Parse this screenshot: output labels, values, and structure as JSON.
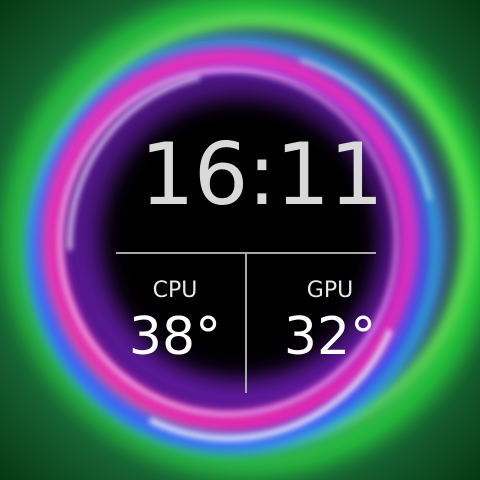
{
  "clock": {
    "time": "16:11"
  },
  "stats": {
    "cpu": {
      "label": "CPU",
      "value": "38°"
    },
    "gpu": {
      "label": "GPU",
      "value": "32°"
    }
  },
  "colors": {
    "time_text": "#d9d9d9",
    "divider": "#a9a9a9",
    "ring_green": "#3cff3c",
    "ring_pink": "#ff2fb0",
    "ring_blue": "#3a5cff",
    "ring_purple": "#9b2cff"
  }
}
